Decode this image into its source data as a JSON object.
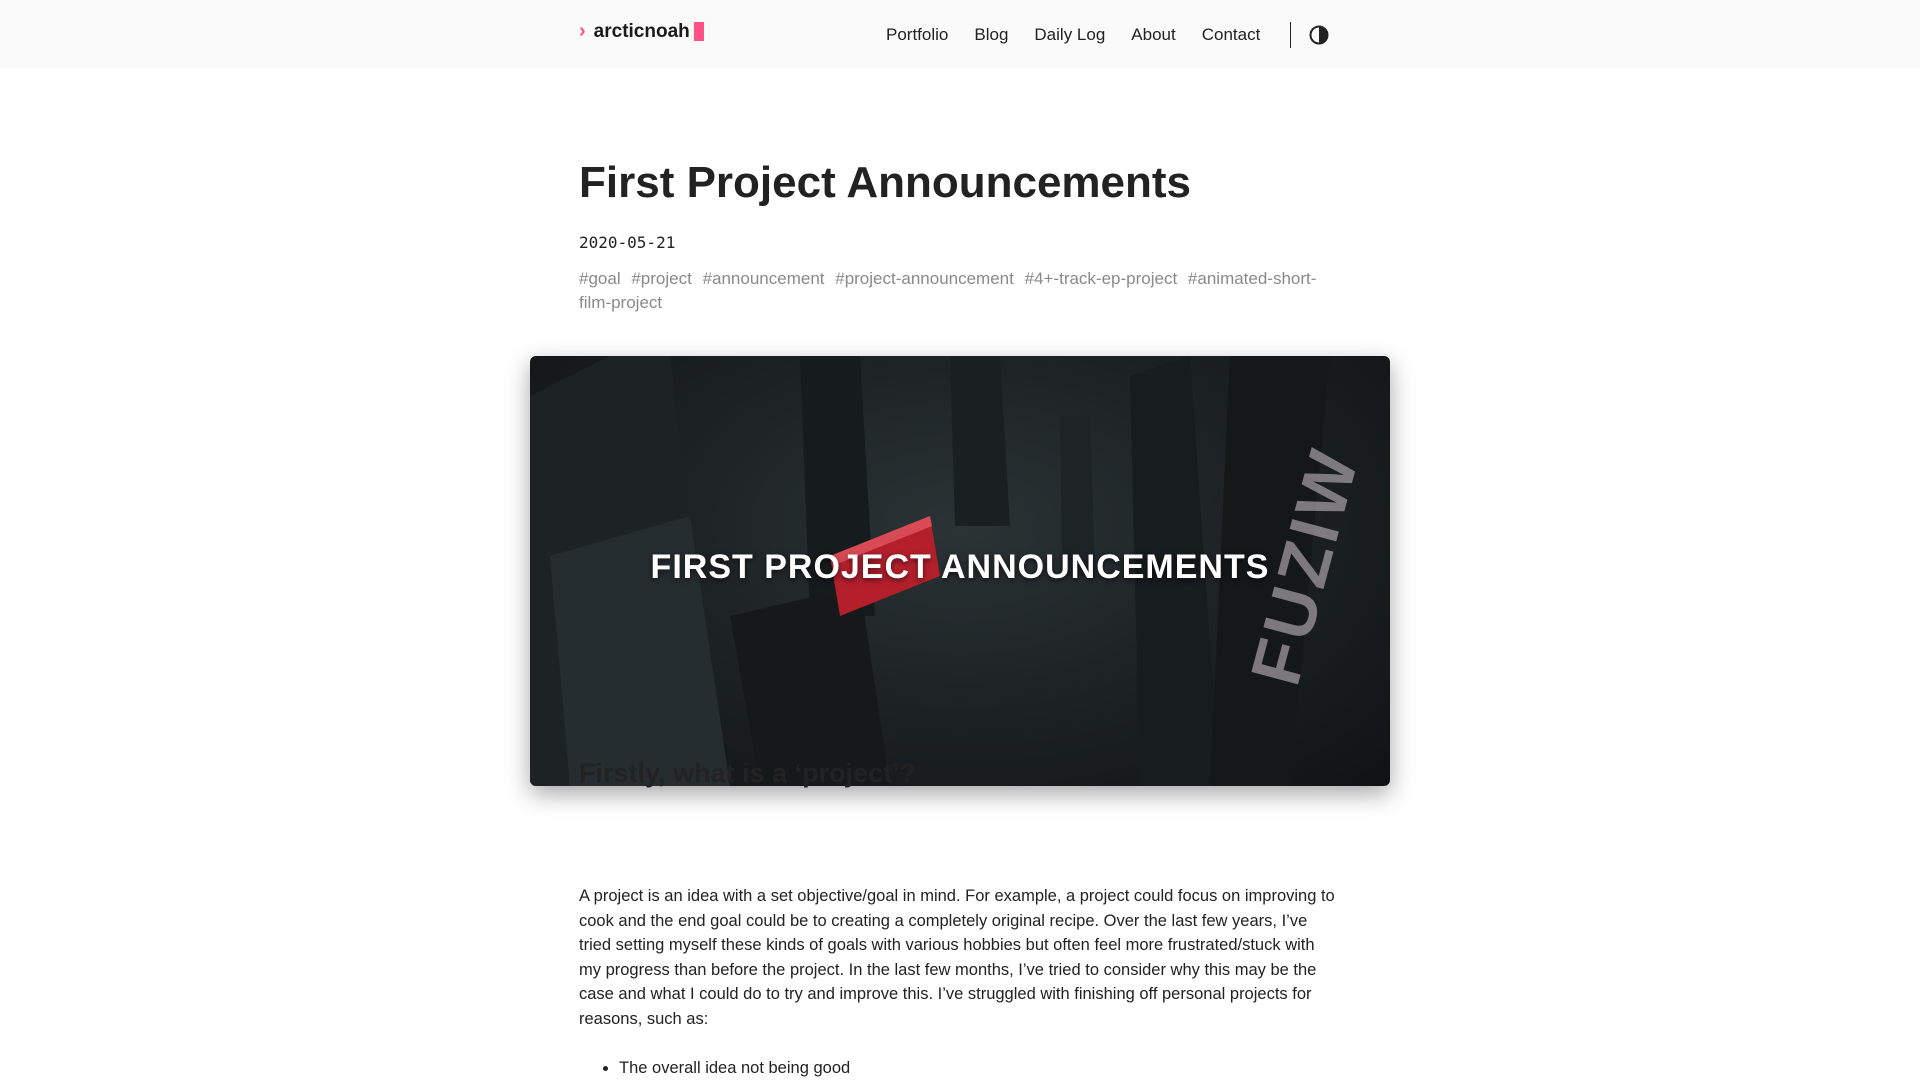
{
  "header": {
    "logo_text": "arcticnoah",
    "nav": [
      {
        "label": "Portfolio"
      },
      {
        "label": "Blog"
      },
      {
        "label": "Daily Log"
      },
      {
        "label": "About"
      },
      {
        "label": "Contact"
      }
    ],
    "theme_toggle_icon": "contrast-icon"
  },
  "post": {
    "title": "First Project Announcements",
    "date": "2020-05-21",
    "tags": [
      "#goal",
      "#project",
      "#announcement",
      "#project-announcement",
      "#4+-track-ep-project",
      "#animated-short-film-project"
    ],
    "hero": {
      "title": "FIRST PROJECT ANNOUNCEMENTS",
      "side_text": "FUZIW"
    },
    "section_heading": "Firstly, what is a ‘project’?",
    "paragraph": "A project is an idea with a set objective/goal in mind. For example, a project could focus on improving to cook and the end goal could be to creating a completely original recipe. Over the last few years, I’ve tried setting myself these kinds of goals with various hobbies but often feel more frustrated/stuck with my progress than before the project. In the last few months, I’ve tried to consider why this may be the case and what I could do to try and improve this. I’ve struggled with finishing off personal projects for reasons, such as:",
    "bullets": [
      "The overall idea not being good"
    ]
  },
  "colors": {
    "accent": "#fe5186",
    "header_bg": "#fafafa",
    "tag_color": "#8a8a8a"
  }
}
